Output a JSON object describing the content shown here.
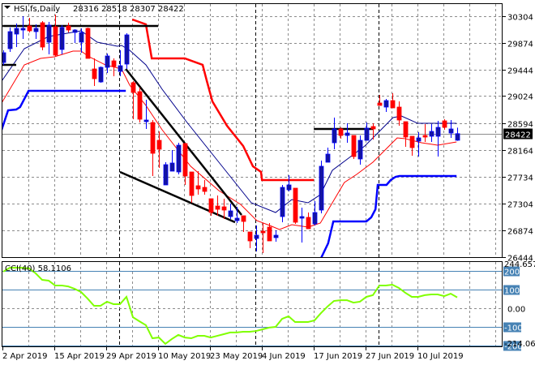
{
  "chart_data": {
    "type": "candlestick",
    "title": "HSI,fs,Daily",
    "ohlc_label": "28316 28518 28307 28422",
    "symbol": "HSI,fs",
    "timeframe": "Daily",
    "current_price": "28422",
    "ylim": [
      26444,
      30304
    ],
    "y_ticks": [
      "30304",
      "29874",
      "29444",
      "29024",
      "28594",
      "28164",
      "27734",
      "27304",
      "26874",
      "26444"
    ],
    "x_ticks": [
      {
        "bar": 1,
        "label": "2 Apr 2019"
      },
      {
        "bar": 9,
        "label": "15 Apr 2019"
      },
      {
        "bar": 17,
        "label": "29 Apr 2019"
      },
      {
        "bar": 25,
        "label": "10 May 2019"
      },
      {
        "bar": 33,
        "label": "23 May 2019"
      },
      {
        "bar": 41,
        "label": "4 Jun 2019"
      },
      {
        "bar": 49,
        "label": "17 Jun 2019"
      },
      {
        "bar": 57,
        "label": "27 Jun 2019"
      },
      {
        "bar": 65,
        "label": "10 Jul 2019"
      }
    ],
    "candles_ohlc": [
      [
        29563,
        29758,
        29524,
        29719
      ],
      [
        29784,
        30122,
        29732,
        30057
      ],
      [
        30018,
        30187,
        29810,
        30109
      ],
      [
        30083,
        30304,
        29940,
        30109
      ],
      [
        30148,
        30278,
        30044,
        30070
      ],
      [
        30057,
        30174,
        29940,
        30109
      ],
      [
        30200,
        30226,
        29758,
        29810
      ],
      [
        29888,
        30213,
        29693,
        30161
      ],
      [
        30135,
        30330,
        29654,
        29680
      ],
      [
        29771,
        30161,
        29693,
        30122
      ],
      [
        30148,
        30200,
        30044,
        30083
      ],
      [
        30044,
        30096,
        29875,
        30083
      ],
      [
        29888,
        30109,
        29719,
        30044
      ],
      [
        30109,
        30122,
        29628,
        29628
      ],
      [
        29459,
        29628,
        29186,
        29303
      ],
      [
        29251,
        29498,
        29238,
        29485
      ],
      [
        29485,
        29706,
        29394,
        29667
      ],
      [
        29589,
        29628,
        29342,
        29498
      ],
      [
        29420,
        29758,
        29342,
        29511
      ],
      [
        29537,
        30031,
        29459,
        30005
      ],
      [
        29238,
        29264,
        28653,
        29082
      ],
      [
        29095,
        29160,
        28601,
        28653
      ],
      [
        28614,
        28965,
        28497,
        28640
      ],
      [
        28601,
        28640,
        27743,
        28107
      ],
      [
        28315,
        28458,
        27873,
        28172
      ],
      [
        27600,
        27964,
        27600,
        27925
      ],
      [
        27821,
        28159,
        27821,
        27951
      ],
      [
        27808,
        28276,
        27769,
        28237
      ],
      [
        28263,
        28276,
        27600,
        27743
      ],
      [
        27808,
        27808,
        27314,
        27431
      ],
      [
        27587,
        27821,
        27444,
        27535
      ],
      [
        27561,
        27678,
        27444,
        27496
      ],
      [
        27379,
        27379,
        27106,
        27158
      ],
      [
        27262,
        27431,
        27106,
        27210
      ],
      [
        27249,
        27379,
        27054,
        27197
      ],
      [
        27093,
        27301,
        27054,
        27184
      ],
      [
        27028,
        27249,
        26989,
        27067
      ],
      [
        27106,
        27106,
        26846,
        27015
      ],
      [
        26846,
        26846,
        26586,
        26703
      ],
      [
        26742,
        26950,
        26534,
        26794
      ],
      [
        26859,
        26989,
        26508,
        26833
      ],
      [
        26924,
        26989,
        26703,
        26703
      ],
      [
        26755,
        26872,
        26690,
        26794
      ],
      [
        27093,
        27600,
        27002,
        27561
      ],
      [
        27522,
        27756,
        27496,
        27600
      ],
      [
        27548,
        27548,
        26976,
        27002
      ],
      [
        27067,
        27236,
        26677,
        27093
      ],
      [
        27080,
        27158,
        26898,
        26898
      ],
      [
        26976,
        27340,
        26950,
        27158
      ],
      [
        27197,
        27990,
        27145,
        27899
      ],
      [
        27964,
        28198,
        27964,
        28094
      ],
      [
        28276,
        28679,
        28172,
        28497
      ],
      [
        28497,
        28523,
        28341,
        28393
      ],
      [
        28393,
        28588,
        28276,
        28432
      ],
      [
        28393,
        28393,
        28016,
        28055
      ],
      [
        28016,
        28393,
        27925,
        28315
      ],
      [
        28315,
        28601,
        28315,
        28510
      ],
      [
        28536,
        28588,
        28328,
        28497
      ],
      [
        28913,
        29043,
        28874,
        28874
      ],
      [
        28848,
        28978,
        28770,
        28952
      ],
      [
        28952,
        29069,
        28835,
        28835
      ],
      [
        28848,
        28939,
        28549,
        28640
      ],
      [
        28614,
        28614,
        28211,
        28367
      ],
      [
        28380,
        28380,
        28068,
        28198
      ],
      [
        28302,
        28445,
        28055,
        28354
      ],
      [
        28393,
        28575,
        28289,
        28367
      ],
      [
        28380,
        28575,
        28289,
        28458
      ],
      [
        28380,
        28627,
        28055,
        28523
      ],
      [
        28627,
        28653,
        28484,
        28523
      ],
      [
        28432,
        28640,
        28354,
        28497
      ],
      [
        28316,
        28518,
        28307,
        28422
      ]
    ],
    "overlays": [
      {
        "name": "ma-fast-blue",
        "color": "#00008b",
        "points": [
          [
            0.75,
            29264
          ],
          [
            4.25,
            29784
          ],
          [
            8,
            29979
          ],
          [
            13,
            30070
          ],
          [
            15.5,
            29888
          ],
          [
            18.6,
            29823
          ],
          [
            19.25,
            29836
          ],
          [
            20.5,
            29758
          ],
          [
            23,
            29524
          ],
          [
            25.5,
            29134
          ],
          [
            29.25,
            28614
          ],
          [
            34.25,
            27964
          ],
          [
            39.25,
            27314
          ],
          [
            43,
            27158
          ],
          [
            45.5,
            27366
          ],
          [
            48,
            27314
          ],
          [
            49.9,
            27444
          ],
          [
            51.75,
            27834
          ],
          [
            54.25,
            28029
          ],
          [
            56.75,
            28224
          ],
          [
            59.25,
            28484
          ],
          [
            61.1,
            28679
          ],
          [
            62.4,
            28705
          ],
          [
            64.9,
            28588
          ],
          [
            68,
            28588
          ],
          [
            70.9,
            28588
          ]
        ]
      },
      {
        "name": "ma-slow-red",
        "color": "#ff0000",
        "points": [
          [
            0.75,
            28913
          ],
          [
            4.25,
            29524
          ],
          [
            6.75,
            29628
          ],
          [
            8.9,
            29654
          ],
          [
            11.75,
            29745
          ],
          [
            13,
            29745
          ],
          [
            14.25,
            29654
          ],
          [
            16.75,
            29524
          ],
          [
            19.25,
            29459
          ],
          [
            20.5,
            29199
          ],
          [
            23,
            28874
          ],
          [
            25.5,
            28484
          ],
          [
            29.9,
            27899
          ],
          [
            34.25,
            27509
          ],
          [
            37.6,
            27288
          ],
          [
            40.1,
            27028
          ],
          [
            42.1,
            26950
          ],
          [
            43.6,
            26885
          ],
          [
            45.5,
            26963
          ],
          [
            48,
            26924
          ],
          [
            49.9,
            26989
          ],
          [
            51.75,
            27314
          ],
          [
            53.6,
            27639
          ],
          [
            55.5,
            27769
          ],
          [
            58,
            27964
          ],
          [
            59.25,
            28094
          ],
          [
            60.5,
            28224
          ],
          [
            61.75,
            28354
          ],
          [
            63,
            28341
          ],
          [
            65.5,
            28276
          ],
          [
            68,
            28237
          ],
          [
            70.9,
            28289
          ]
        ]
      },
      {
        "name": "resistance-step-red",
        "color": "#ff0000",
        "thick": true,
        "points": [
          [
            20.9,
            30252
          ],
          [
            23,
            30174
          ],
          [
            23.9,
            29628
          ],
          [
            29,
            29628
          ],
          [
            31.75,
            29524
          ],
          [
            32.4,
            29264
          ],
          [
            33.25,
            28939
          ],
          [
            35.5,
            28549
          ],
          [
            38,
            28224
          ],
          [
            39.5,
            27899
          ],
          [
            40.75,
            27808
          ],
          [
            40.9,
            27678
          ],
          [
            48.9,
            27678
          ]
        ]
      },
      {
        "name": "support-step-blue-1",
        "color": "#0000ff",
        "thick": true,
        "points": [
          [
            0.75,
            28484
          ],
          [
            1.75,
            28796
          ],
          [
            3,
            28809
          ],
          [
            3.6,
            28848
          ],
          [
            4.9,
            29108
          ],
          [
            19.9,
            29108
          ]
        ]
      },
      {
        "name": "support-step-blue-2",
        "color": "#0000ff",
        "thick": true,
        "points": [
          [
            49.9,
            26404
          ],
          [
            51.1,
            26664
          ],
          [
            51.9,
            27015
          ],
          [
            57,
            27015
          ],
          [
            57.75,
            27080
          ],
          [
            58.4,
            27210
          ],
          [
            58.75,
            27600
          ],
          [
            60.1,
            27600
          ],
          [
            60.75,
            27678
          ],
          [
            61.5,
            27730
          ],
          [
            62.1,
            27743
          ],
          [
            70.9,
            27743
          ]
        ]
      }
    ],
    "trendlines": [
      {
        "name": "horizontal-resistance-top",
        "points": [
          [
            0.9,
            30148
          ],
          [
            24.9,
            30148
          ]
        ]
      },
      {
        "name": "horizontal-level-short",
        "points": [
          [
            0.75,
            29524
          ],
          [
            3,
            29524
          ]
        ]
      },
      {
        "name": "falling-wedge-upper",
        "points": [
          [
            19.9,
            29459
          ],
          [
            37.75,
            27119
          ]
        ]
      },
      {
        "name": "falling-wedge-lower",
        "points": [
          [
            19,
            27808
          ],
          [
            36.75,
            27002
          ]
        ]
      },
      {
        "name": "horizontal-resistance-june",
        "points": [
          [
            48.9,
            28497
          ],
          [
            58,
            28497
          ]
        ]
      }
    ],
    "cci": {
      "label": "CCI(40) 58.1106",
      "max_label": "244.6572",
      "min_label": "-214.0625",
      "levels": [
        "200",
        "100",
        "0.00",
        "-100",
        "-200"
      ],
      "level_values": [
        200,
        100,
        0,
        -100,
        -200
      ],
      "color": "#80ff00",
      "values": [
        196,
        217,
        217,
        217,
        213,
        187,
        152,
        148,
        122,
        122,
        117,
        104,
        87,
        52,
        13,
        13,
        35,
        22,
        22,
        61,
        -48,
        -70,
        -91,
        -161,
        -157,
        -191,
        -165,
        -143,
        -157,
        -161,
        -148,
        -148,
        -157,
        -148,
        -139,
        -130,
        -130,
        -126,
        -126,
        -122,
        -113,
        -104,
        -100,
        -57,
        -43,
        -74,
        -74,
        -74,
        -65,
        -26,
        9,
        39,
        43,
        43,
        30,
        35,
        61,
        70,
        122,
        122,
        126,
        109,
        83,
        61,
        61,
        70,
        74,
        74,
        65,
        78,
        58.11
      ]
    },
    "colors": {
      "bull": "#0000ff",
      "bull_fill": "#1414a0",
      "bear": "#ff0000",
      "grid": "#8c8c8c",
      "level": "#4682b4"
    }
  }
}
